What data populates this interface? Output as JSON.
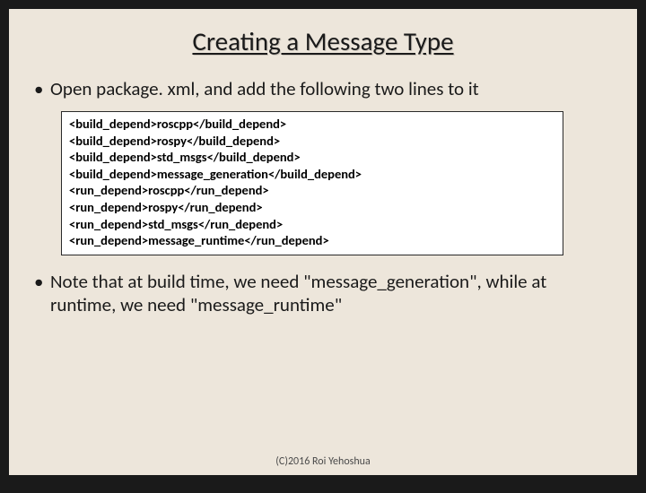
{
  "title": "Creating a Message Type",
  "bullets": {
    "b1": "Open package. xml, and add the following two lines to it",
    "b2": "Note that at build time, we need \"message_generation\", while at runtime, we need \"message_runtime\""
  },
  "code": {
    "l1": "<build_depend>roscpp</build_depend>",
    "l2": "<build_depend>rospy</build_depend>",
    "l3": "<build_depend>std_msgs</build_depend>",
    "l4": "<build_depend>message_generation</build_depend>",
    "l5": "<run_depend>roscpp</run_depend>",
    "l6": "<run_depend>rospy</run_depend>",
    "l7": "<run_depend>std_msgs</run_depend>",
    "l8": "<run_depend>message_runtime</run_depend>"
  },
  "footer": "(C)2016 Roi Yehoshua"
}
